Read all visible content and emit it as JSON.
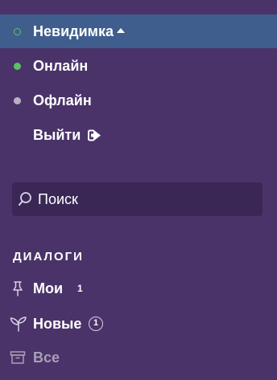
{
  "status_menu": {
    "items": [
      {
        "label": "Невидимка",
        "status": "invisible",
        "selected": true
      },
      {
        "label": "Онлайн",
        "status": "online",
        "selected": false
      },
      {
        "label": "Офлайн",
        "status": "offline",
        "selected": false
      }
    ],
    "logout_label": "Выйти"
  },
  "search": {
    "placeholder": "Поиск",
    "value": ""
  },
  "dialogs": {
    "section_title": "ДИАЛОГИ",
    "items": [
      {
        "label": "Мои",
        "count": "1",
        "icon": "pin-icon"
      },
      {
        "label": "Новые",
        "count": "1",
        "icon": "sprout-icon"
      },
      {
        "label": "Все",
        "count": "",
        "icon": "archive-icon"
      }
    ]
  },
  "colors": {
    "background": "#4a3369",
    "selected_item": "#3f5e8d",
    "search_bg": "#3a2756",
    "online": "#58c263",
    "offline": "#b7b2c0",
    "muted_text": "#a99fb8"
  }
}
